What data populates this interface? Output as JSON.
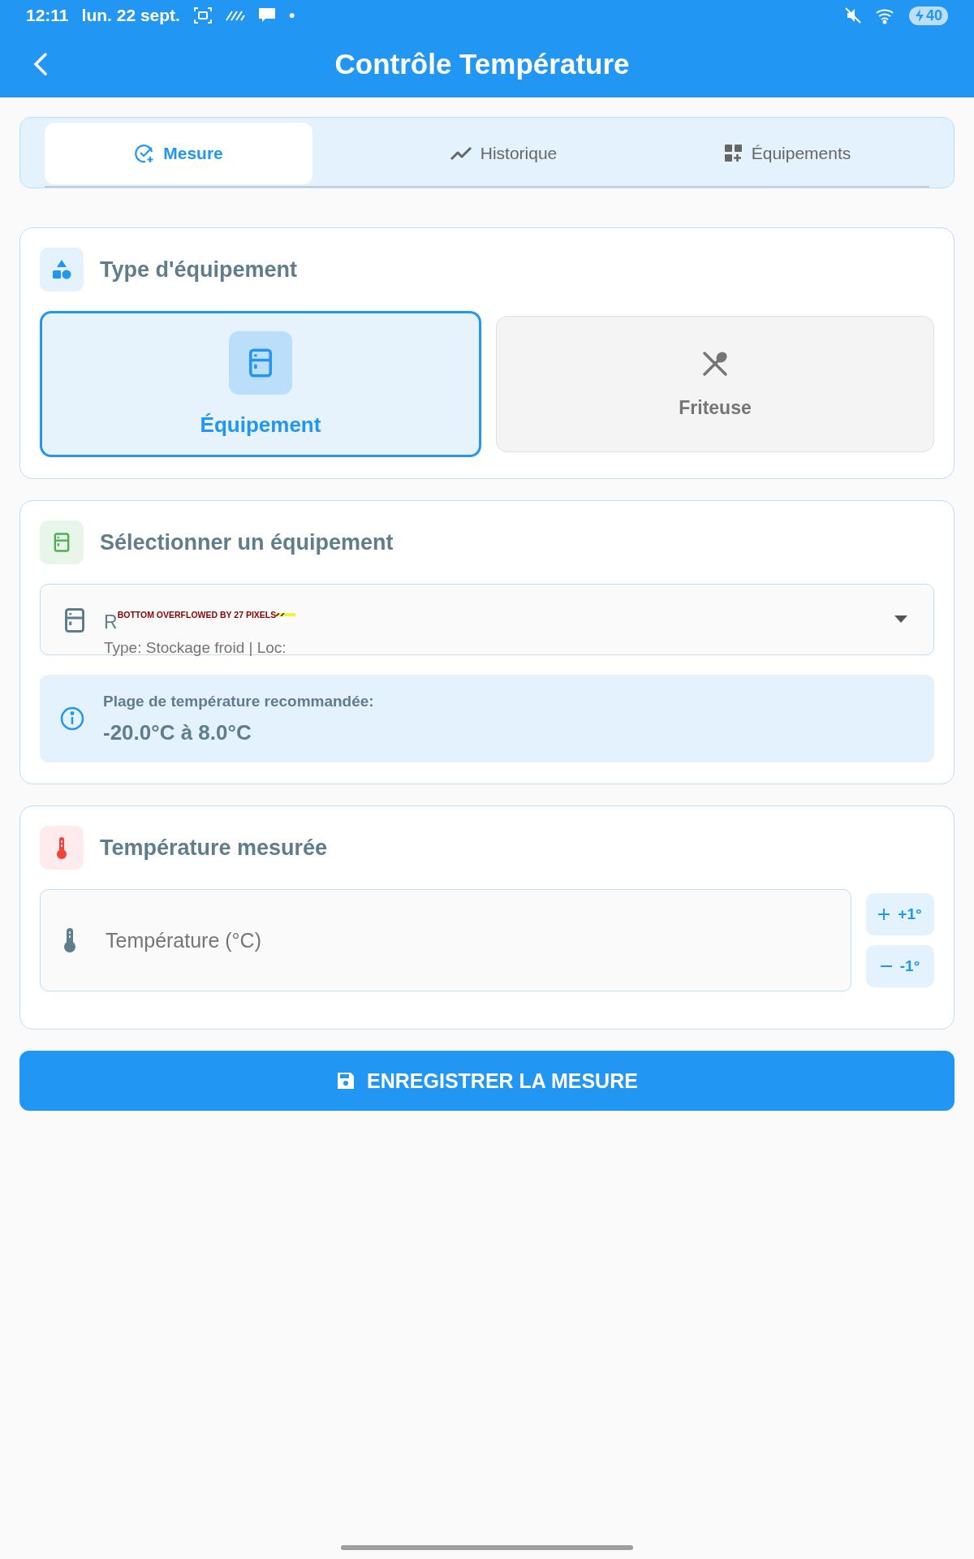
{
  "status_bar": {
    "time": "12:11",
    "date": "lun. 22 sept.",
    "dot": "•",
    "battery": "40"
  },
  "header": {
    "title": "Contrôle Température"
  },
  "tabs": [
    {
      "label": "Mesure",
      "selected": true
    },
    {
      "label": "Historique",
      "selected": false
    },
    {
      "label": "Équipements",
      "selected": false
    }
  ],
  "type_card": {
    "title": "Type d'équipement",
    "options": [
      {
        "label": "Équipement",
        "selected": true
      },
      {
        "label": "Friteuse",
        "selected": false
      }
    ]
  },
  "equipment_card": {
    "title": "Sélectionner un équipement",
    "dropdown": {
      "value": "R",
      "subtitle": "Type: Stockage froid | Loc:"
    },
    "overflow_warning": "BOTTOM OVERFLOWED BY 27 PIXELS",
    "range": {
      "label": "Plage de température recommandée:",
      "value": "-20.0°C à 8.0°C"
    }
  },
  "temperature_card": {
    "title": "Température mesurée",
    "input": {
      "placeholder": "Température (°C)"
    },
    "steppers": [
      {
        "label": "+1°"
      },
      {
        "label": "-1°"
      }
    ]
  },
  "save_button": {
    "label": "ENREGISTRER LA MESURE"
  }
}
